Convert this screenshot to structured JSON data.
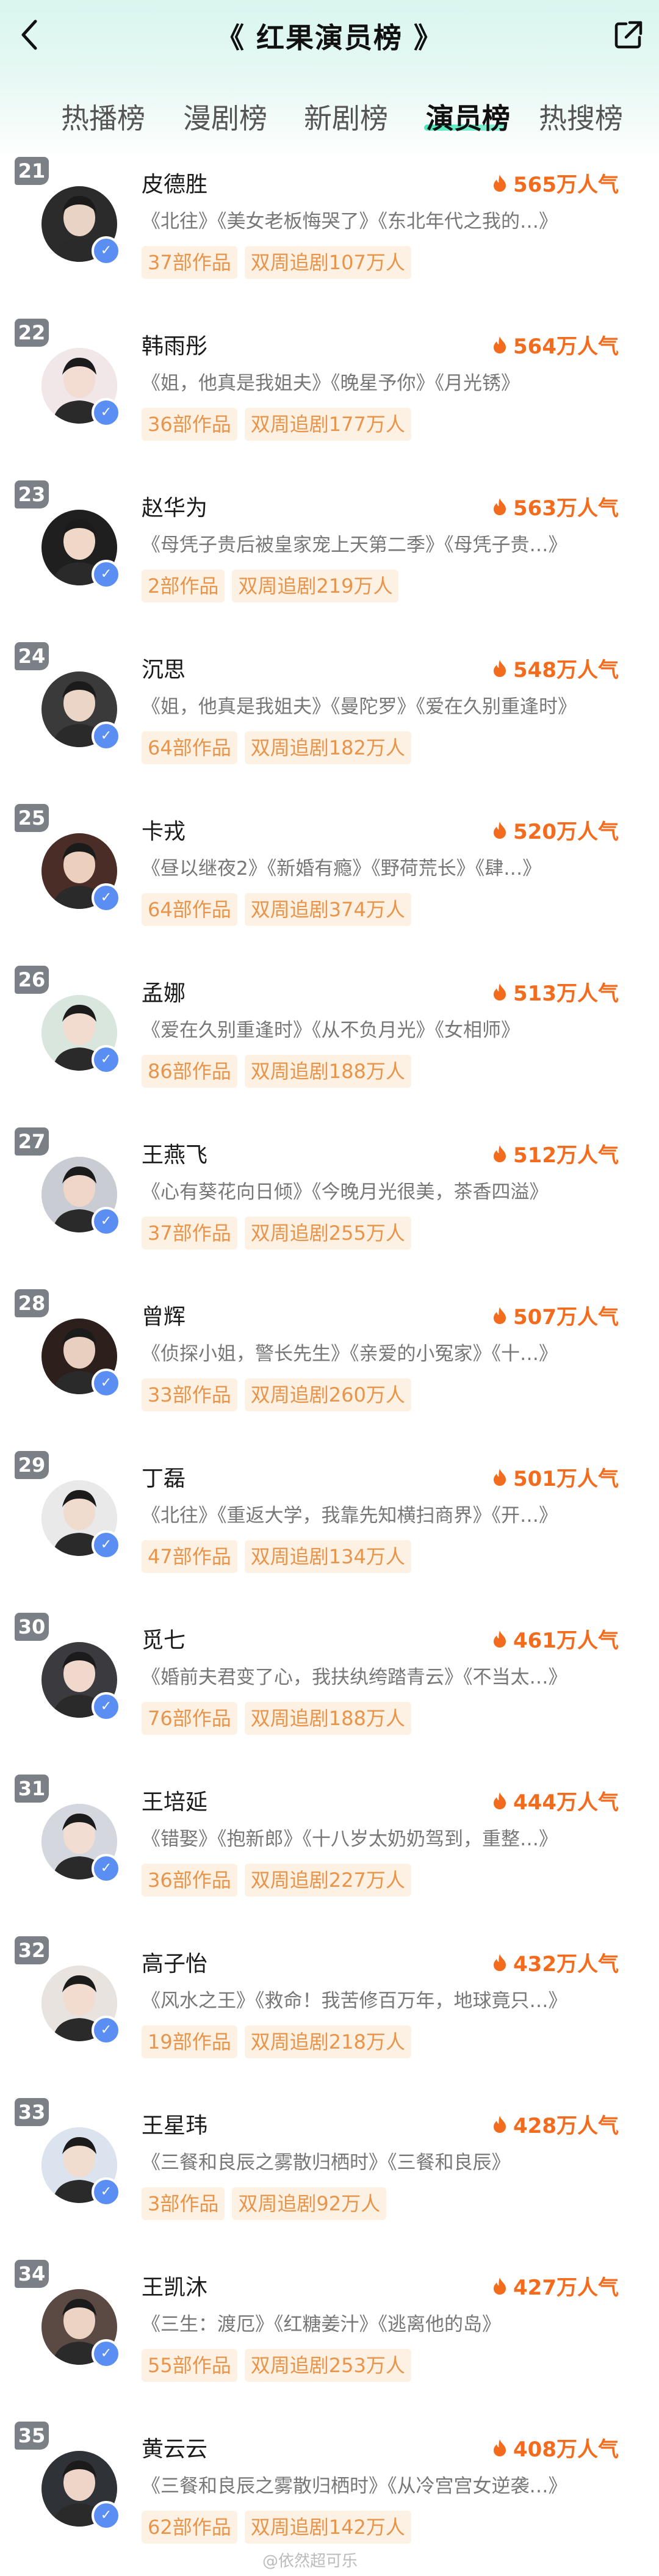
{
  "header": {
    "title": "《 红果演员榜 》"
  },
  "tabs": [
    {
      "label": "热播榜",
      "active": false
    },
    {
      "label": "漫剧榜",
      "active": false
    },
    {
      "label": "新剧榜",
      "active": false
    },
    {
      "label": "演员榜",
      "active": true
    },
    {
      "label": "热搜榜",
      "active": false
    }
  ],
  "colors": {
    "accent_orange": "#f36c1e",
    "chip_bg": "#fdf1e4",
    "chip_text": "#e8944a",
    "rank_badge": "#7b7f86",
    "tab_underline": "#2ee5b0",
    "header_bg": "#d9f6ef"
  },
  "icons": {
    "back": "chevron-left-icon",
    "share": "share-icon",
    "popularity": "flame-icon",
    "verified": "verified-badge-icon"
  },
  "actors": [
    {
      "rank": "21",
      "name": "皮德胜",
      "popularity": "565万人气",
      "works": "《北往》《美女老板悔哭了》《东北年代之我的…》",
      "count": "37部作品",
      "follow": "双周追剧107万人"
    },
    {
      "rank": "22",
      "name": "韩雨彤",
      "popularity": "564万人气",
      "works": "《姐，他真是我姐夫》《晚星予你》《月光锈》",
      "count": "36部作品",
      "follow": "双周追剧177万人"
    },
    {
      "rank": "23",
      "name": "赵华为",
      "popularity": "563万人气",
      "works": "《母凭子贵后被皇家宠上天第二季》《母凭子贵…》",
      "count": "2部作品",
      "follow": "双周追剧219万人"
    },
    {
      "rank": "24",
      "name": "沉思",
      "popularity": "548万人气",
      "works": "《姐，他真是我姐夫》《曼陀罗》《爱在久别重逢时》",
      "count": "64部作品",
      "follow": "双周追剧182万人"
    },
    {
      "rank": "25",
      "name": "卡戎",
      "popularity": "520万人气",
      "works": "《昼以继夜2》《新婚有瘾》《野荷荒长》《肆…》",
      "count": "64部作品",
      "follow": "双周追剧374万人"
    },
    {
      "rank": "26",
      "name": "孟娜",
      "popularity": "513万人气",
      "works": "《爱在久别重逢时》《从不负月光》《女相师》",
      "count": "86部作品",
      "follow": "双周追剧188万人"
    },
    {
      "rank": "27",
      "name": "王燕飞",
      "popularity": "512万人气",
      "works": "《心有葵花向日倾》《今晚月光很美，茶香四溢》",
      "count": "37部作品",
      "follow": "双周追剧255万人"
    },
    {
      "rank": "28",
      "name": "曾辉",
      "popularity": "507万人气",
      "works": "《侦探小姐，警长先生》《亲爱的小冤家》《十…》",
      "count": "33部作品",
      "follow": "双周追剧260万人"
    },
    {
      "rank": "29",
      "name": "丁磊",
      "popularity": "501万人气",
      "works": "《北往》《重返大学，我靠先知横扫商界》《开…》",
      "count": "47部作品",
      "follow": "双周追剧134万人"
    },
    {
      "rank": "30",
      "name": "觅七",
      "popularity": "461万人气",
      "works": "《婚前夫君变了心，我扶纨绔踏青云》《不当太…》",
      "count": "76部作品",
      "follow": "双周追剧188万人"
    },
    {
      "rank": "31",
      "name": "王培延",
      "popularity": "444万人气",
      "works": "《错娶》《抱新郎》《十八岁太奶奶驾到，重整…》",
      "count": "36部作品",
      "follow": "双周追剧227万人"
    },
    {
      "rank": "32",
      "name": "高子怡",
      "popularity": "432万人气",
      "works": "《风水之王》《救命！我苦修百万年，地球竟只…》",
      "count": "19部作品",
      "follow": "双周追剧218万人"
    },
    {
      "rank": "33",
      "name": "王星玮",
      "popularity": "428万人气",
      "works": "《三餐和良辰之雾散归栖时》《三餐和良辰》",
      "count": "3部作品",
      "follow": "双周追剧92万人"
    },
    {
      "rank": "34",
      "name": "王凯沐",
      "popularity": "427万人气",
      "works": "《三生：渡厄》《红糖姜汁》《逃离他的岛》",
      "count": "55部作品",
      "follow": "双周追剧253万人"
    },
    {
      "rank": "35",
      "name": "黄云云",
      "popularity": "408万人气",
      "works": "《三餐和良辰之雾散归栖时》《从冷宫宫女逆袭…》",
      "count": "62部作品",
      "follow": "双周追剧142万人"
    }
  ],
  "watermark": "@依然超可乐"
}
